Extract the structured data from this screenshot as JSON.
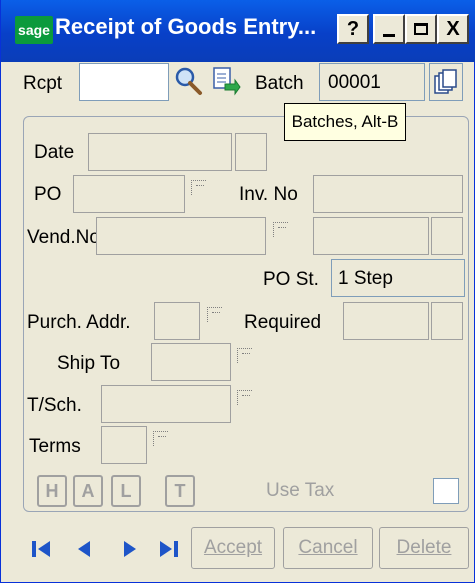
{
  "window": {
    "title": "Receipt of Goods Entry...",
    "logo_text": "sage"
  },
  "titlebar_buttons": {
    "help": "?",
    "minimize": "_",
    "maximize": "□",
    "close": "X"
  },
  "header": {
    "rcpt_label": "Rcpt",
    "rcpt_value": "",
    "batch_label": "Batch",
    "batch_value": "00001",
    "tooltip": "Batches, Alt-B"
  },
  "form": {
    "date_label": "Date",
    "po_label": "PO",
    "inv_no_label": "Inv. No",
    "vend_no_label": "Vend.No.",
    "po_st_label": "PO St.",
    "po_st_value": "1 Step",
    "purch_addr_label": "Purch. Addr.",
    "required_label": "Required",
    "ship_to_label": "Ship To",
    "tsch_label": "T/Sch.",
    "terms_label": "Terms",
    "halt": [
      "H",
      "A",
      "L",
      "T"
    ],
    "use_tax_label": "Use Tax"
  },
  "footer": {
    "accept": "Accept",
    "cancel": "Cancel",
    "delete": "Delete"
  },
  "icons": [
    "first-record-icon",
    "previous-record-icon",
    "next-record-icon",
    "last-record-icon",
    "magnifier-icon",
    "copy-icon",
    "batch-icon"
  ]
}
